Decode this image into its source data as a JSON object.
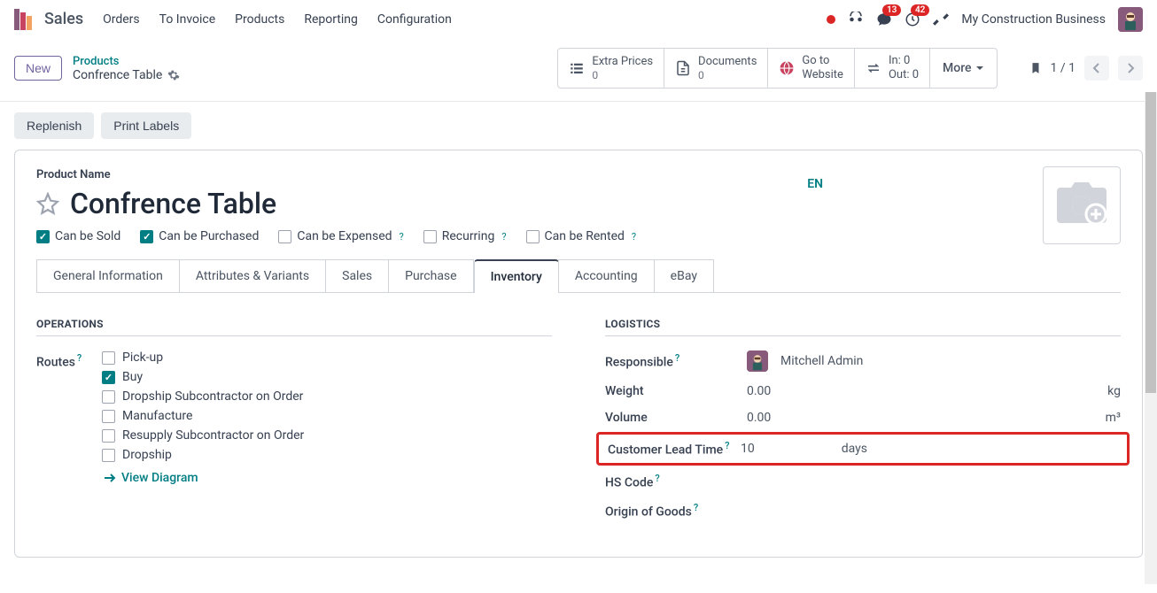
{
  "nav": {
    "app": "Sales",
    "items": [
      "Orders",
      "To Invoice",
      "Products",
      "Reporting",
      "Configuration"
    ],
    "company": "My Construction Business",
    "msg_badge": "13",
    "activity_badge": "42"
  },
  "controlbar": {
    "new": "New",
    "crumb_parent": "Products",
    "crumb_current": "Confrence Table",
    "stats": {
      "extra_prices_label": "Extra Prices",
      "extra_prices_value": "0",
      "documents_label": "Documents",
      "documents_value": "0",
      "goto_label1": "Go to",
      "goto_label2": "Website",
      "in_label": "In: 0",
      "out_label": "Out: 0"
    },
    "more": "More",
    "pager": "1 / 1"
  },
  "actions": {
    "replenish": "Replenish",
    "print_labels": "Print Labels"
  },
  "form": {
    "product_name_label": "Product Name",
    "title": "Confrence Table",
    "lang": "EN",
    "checks": {
      "sold": "Can be Sold",
      "purchased": "Can be Purchased",
      "expensed": "Can be Expensed",
      "recurring": "Recurring",
      "rented": "Can be Rented"
    },
    "tabs": [
      "General Information",
      "Attributes & Variants",
      "Sales",
      "Purchase",
      "Inventory",
      "Accounting",
      "eBay"
    ]
  },
  "operations": {
    "header": "OPERATIONS",
    "routes_label": "Routes",
    "routes": [
      "Pick-up",
      "Buy",
      "Dropship Subcontractor on Order",
      "Manufacture",
      "Resupply Subcontractor on Order",
      "Dropship"
    ],
    "view_diagram": "View Diagram"
  },
  "logistics": {
    "header": "LOGISTICS",
    "responsible_label": "Responsible",
    "responsible_value": "Mitchell Admin",
    "weight_label": "Weight",
    "weight_value": "0.00",
    "weight_unit": "kg",
    "volume_label": "Volume",
    "volume_value": "0.00",
    "volume_unit": "m³",
    "lead_label": "Customer Lead Time",
    "lead_value": "10",
    "lead_unit": "days",
    "hs_label": "HS Code",
    "origin_label": "Origin of Goods"
  }
}
